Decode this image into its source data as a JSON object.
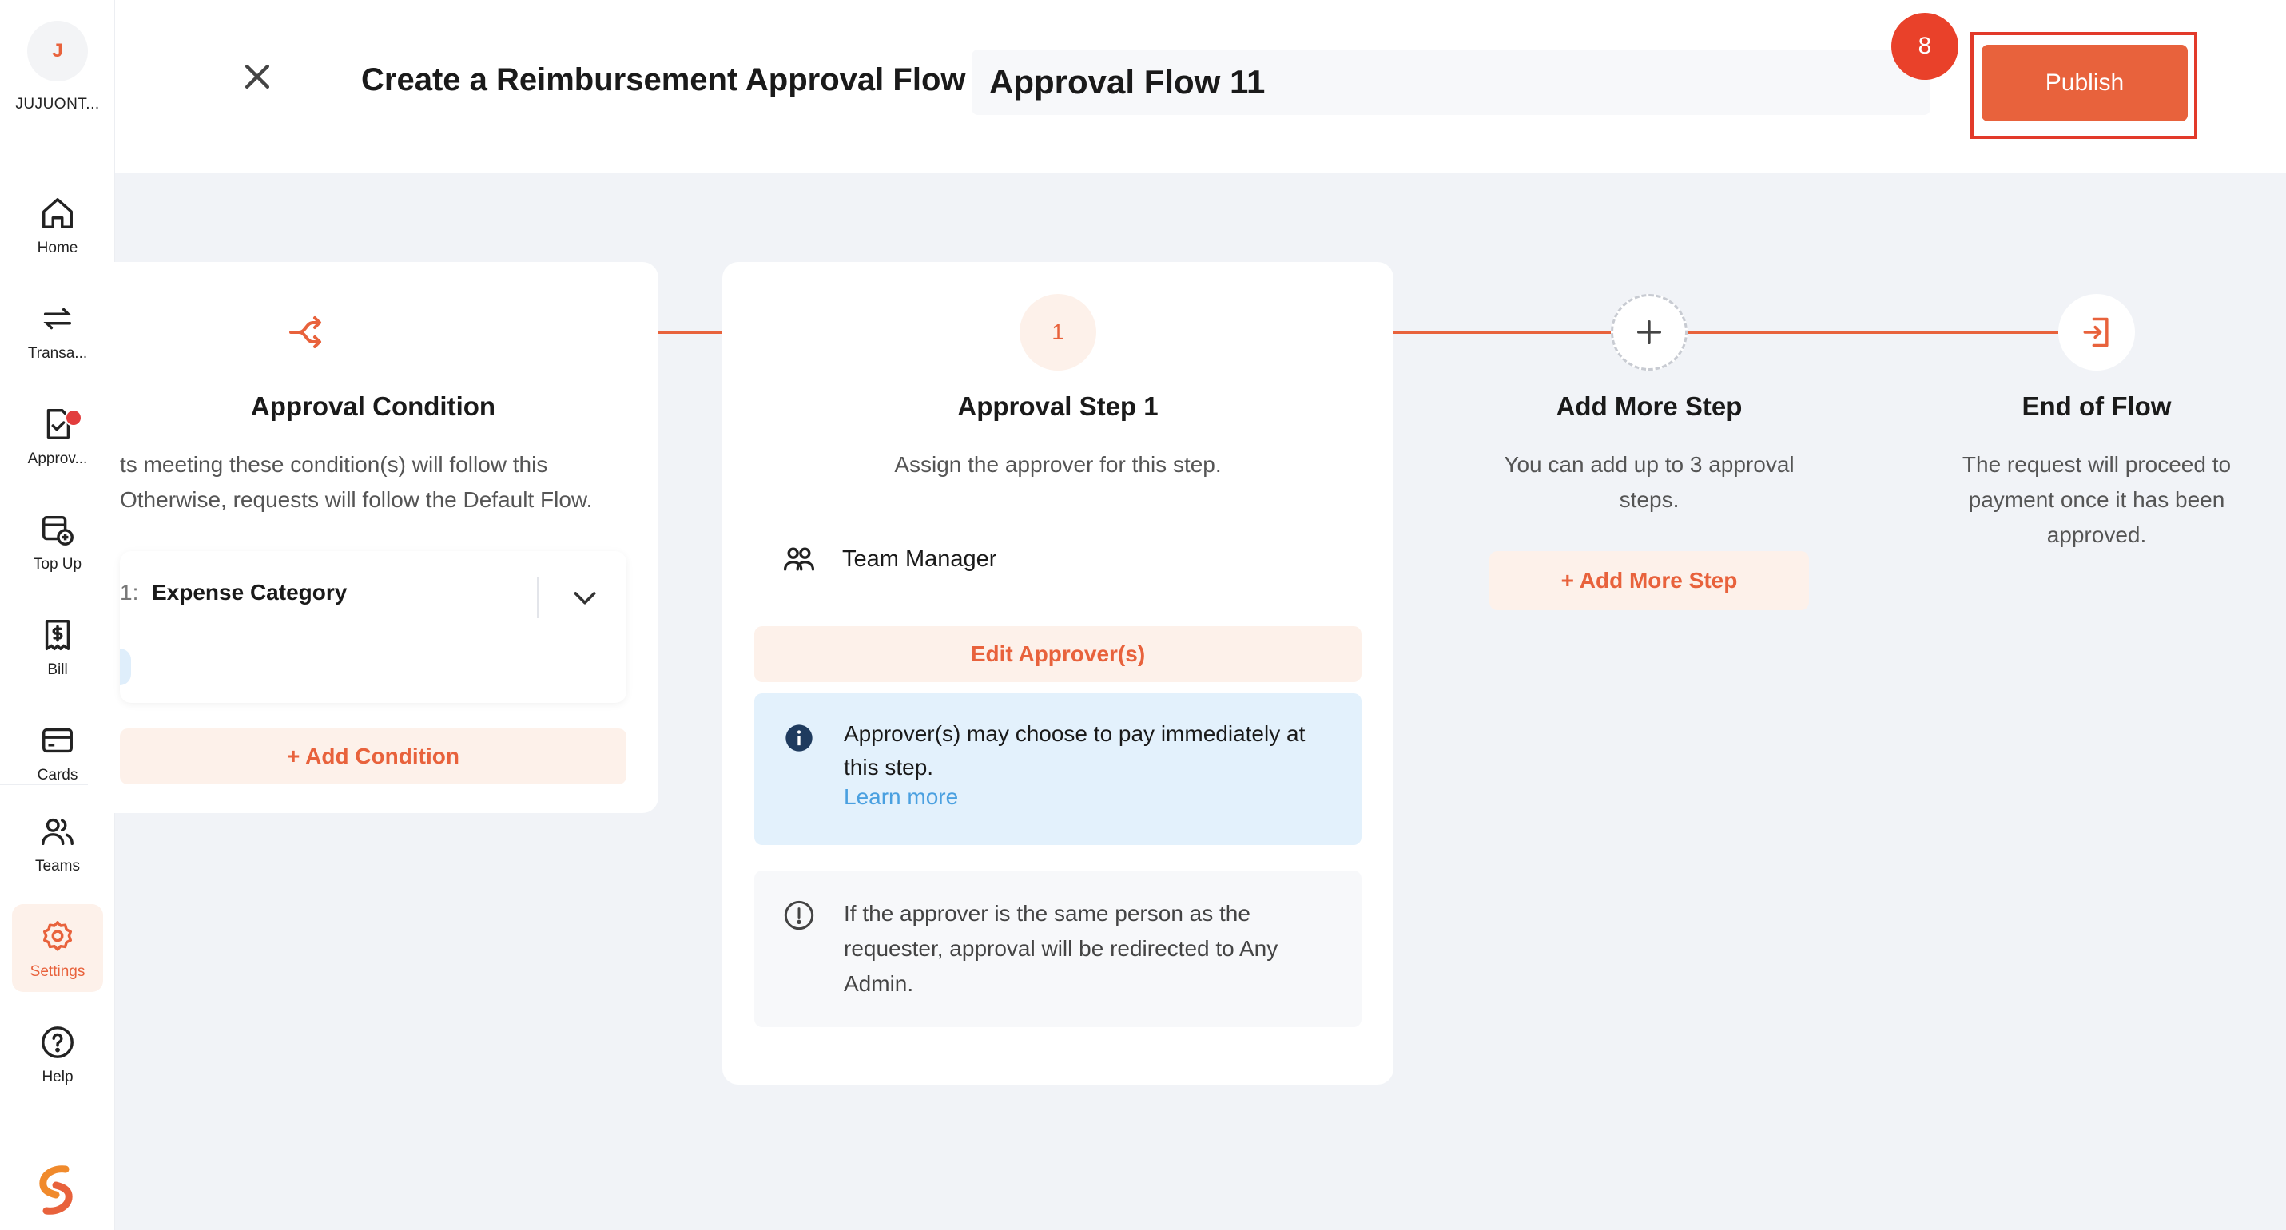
{
  "org": {
    "initial": "J",
    "name": "JUJUONT..."
  },
  "sidebar": {
    "items": [
      {
        "label": "Home",
        "icon": "home-icon"
      },
      {
        "label": "Transa...",
        "icon": "transfer-icon"
      },
      {
        "label": "Approv...",
        "icon": "approval-icon"
      },
      {
        "label": "Top Up",
        "icon": "topup-icon"
      },
      {
        "label": "Bill",
        "icon": "bill-icon"
      },
      {
        "label": "Cards",
        "icon": "card-icon"
      },
      {
        "label": "Teams",
        "icon": "teams-icon"
      },
      {
        "label": "Settings",
        "icon": "gear-icon"
      },
      {
        "label": "Help",
        "icon": "help-icon"
      }
    ],
    "active": "Settings"
  },
  "header": {
    "title": "Create a Reimbursement Approval Flow",
    "flow_name": "Approval Flow 11",
    "step_badge": "8",
    "publish_label": "Publish"
  },
  "condition_card": {
    "title": "Approval Condition",
    "desc_line1": "ts meeting these condition(s) will follow this",
    "desc_line2": "Otherwise, requests will follow the Default Flow.",
    "condition_prefix": "1:",
    "condition_value": "Expense Category",
    "add_condition_label": "+ Add Condition"
  },
  "step_card": {
    "number": "1",
    "title": "Approval Step 1",
    "desc": "Assign the approver for this step.",
    "approver": "Team Manager",
    "edit_label": "Edit Approver(s)",
    "info_text": "Approver(s) may choose to pay immediately at this step.",
    "info_link": "Learn more",
    "warn_text": "If the approver is the same person as the requester, approval will be redirected to Any Admin."
  },
  "add_step": {
    "title": "Add More Step",
    "desc_line1": "You can add up to 3 approval",
    "desc_line2": "steps.",
    "button_label": "+ Add More Step"
  },
  "end_flow": {
    "title": "End of Flow",
    "desc_line1": "The request will proceed to",
    "desc_line2": "payment once it has been",
    "desc_line3": "approved."
  },
  "colors": {
    "accent": "#e8623c",
    "badge": "#e9412a",
    "info_bg": "#e3f1fc",
    "link": "#4aa0e0"
  }
}
